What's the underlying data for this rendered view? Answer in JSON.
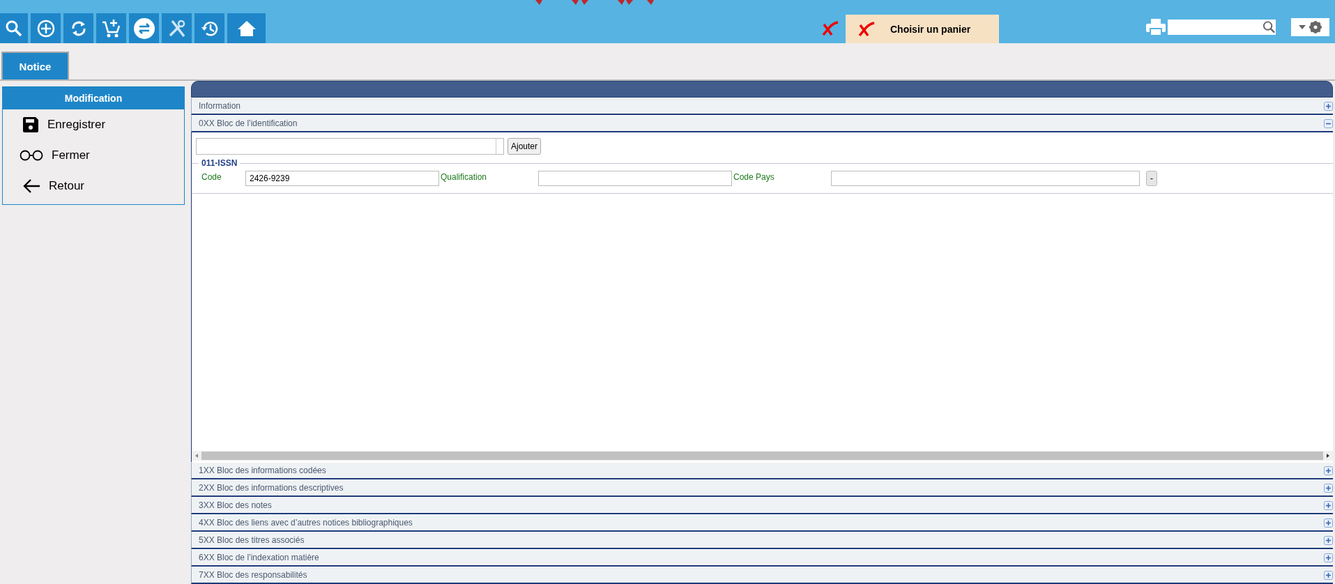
{
  "toolbar": [
    {
      "selected": false
    },
    {
      "selected": false
    },
    {
      "selected": false
    },
    {
      "selected": false
    },
    {
      "selected": true
    },
    {
      "selected": false
    },
    {
      "selected": false
    },
    {
      "selected": false
    }
  ],
  "basket": {
    "label": "Choisir un panier"
  },
  "tabs": [
    {
      "label": "Notice",
      "selected": true
    }
  ],
  "sidebar": {
    "title": "Modification",
    "items": [
      {
        "label": "Enregistrer",
        "kind": "save"
      },
      {
        "label": "Fermer",
        "kind": "close"
      },
      {
        "label": "Retour",
        "kind": "back"
      }
    ]
  },
  "sections": [
    {
      "title": "Information",
      "expanded": false
    },
    {
      "title": "0XX Bloc de l’identification",
      "expanded": true,
      "add_button": "Ajouter",
      "group": "011-ISSN",
      "fields": [
        {
          "label": "Code",
          "value": "2426-9239"
        },
        {
          "label": "Qualification"
        },
        {
          "label": "Code Pays"
        }
      ],
      "remove_button": "-"
    },
    {
      "title": "1XX Bloc des informations codées",
      "expanded": false
    },
    {
      "title": "2XX Bloc des informations descriptives",
      "expanded": false
    },
    {
      "title": "3XX Bloc des notes",
      "expanded": false
    },
    {
      "title": "4XX Bloc des liens avec d’autres notices bibliographiques",
      "expanded": false
    },
    {
      "title": "5XX Bloc des titres associés",
      "expanded": false
    },
    {
      "title": "6XX Bloc de l’indexation matière",
      "expanded": false
    },
    {
      "title": "7XX Bloc des responsabilités",
      "expanded": false
    }
  ]
}
